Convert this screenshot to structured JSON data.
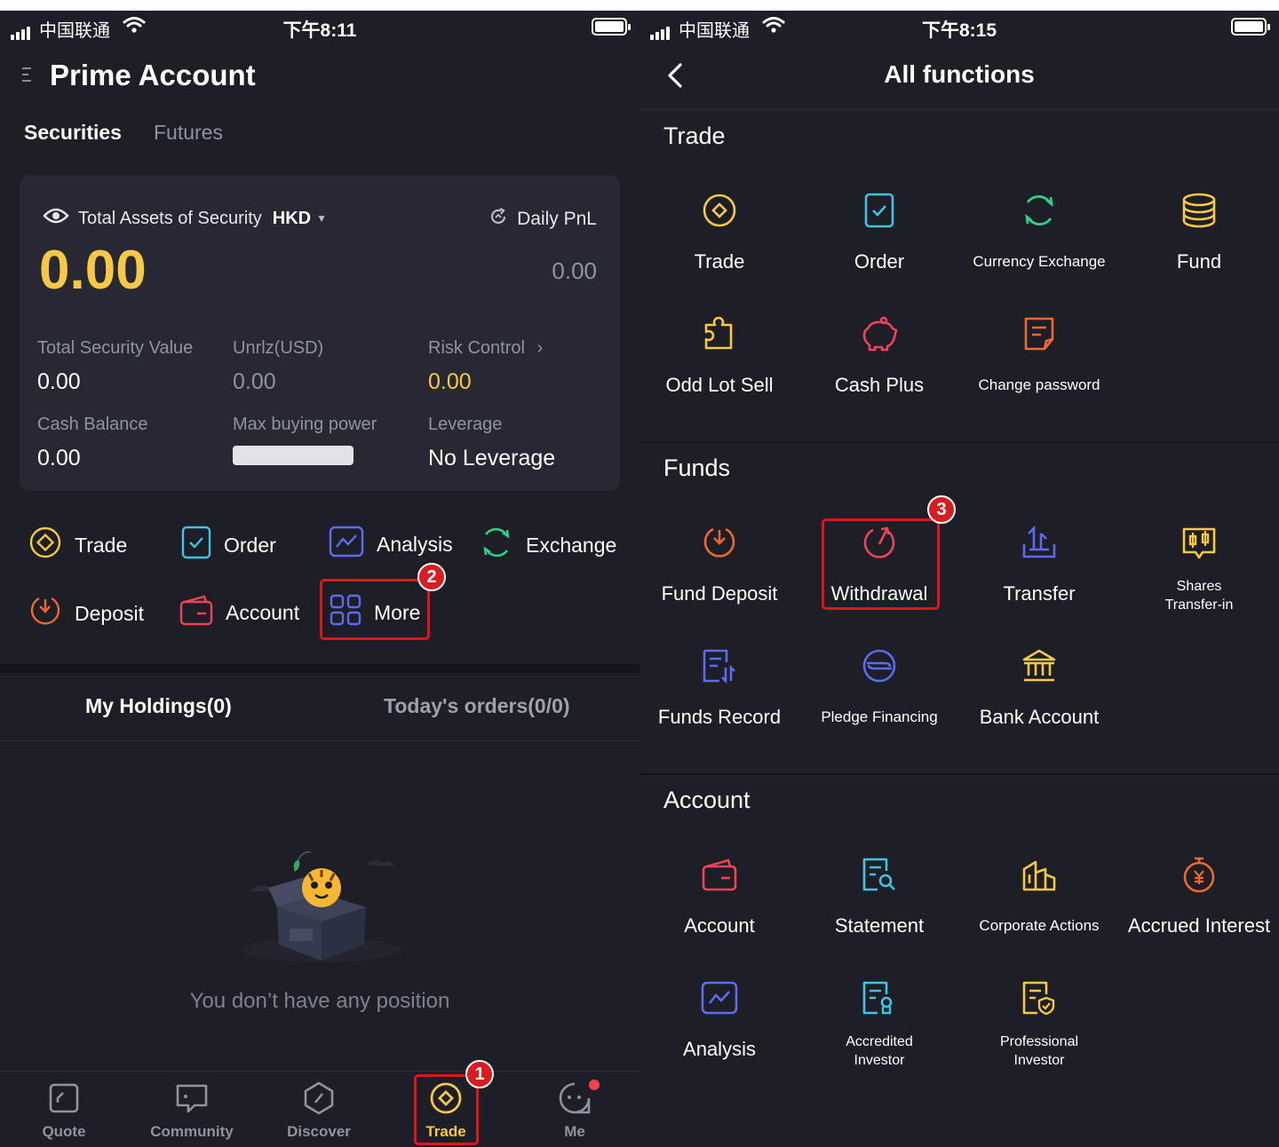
{
  "status_left": {
    "carrier": "中国联通",
    "time": "下午8:11"
  },
  "status_right": {
    "carrier": "中国联通",
    "time": "下午8:15"
  },
  "left": {
    "title": "Prime Account",
    "tabs": [
      "Securities",
      "Futures"
    ],
    "assets": {
      "label": "Total Assets of Security",
      "currency": "HKD",
      "daily_pnl_label": "Daily PnL",
      "total": "0.00",
      "daily_pnl_value": "0.00",
      "metrics": [
        {
          "label": "Total Security Value",
          "value": "0.00"
        },
        {
          "label": "Unrlz(USD)",
          "value": "0.00"
        },
        {
          "label": "Risk Control",
          "value": "0.00"
        },
        {
          "label": "Cash Balance",
          "value": "0.00"
        },
        {
          "label": "Max buying power",
          "value": ""
        },
        {
          "label": "Leverage",
          "value": "No Leverage"
        }
      ]
    },
    "quick_actions": [
      "Trade",
      "Order",
      "Analysis",
      "Exchange",
      "Deposit",
      "Account",
      "More"
    ],
    "holdings_tabs": [
      "My Holdings(0)",
      "Today's orders(0/0)"
    ],
    "empty_text": "You don’t have any position",
    "bottom_tabs": [
      "Quote",
      "Community",
      "Discover",
      "Trade",
      "Me"
    ]
  },
  "right": {
    "title": "All functions",
    "sections": [
      {
        "title": "Trade",
        "items": [
          "Trade",
          "Order",
          "Currency Exchange",
          "Fund",
          "Odd Lot Sell",
          "Cash Plus",
          "Change password"
        ]
      },
      {
        "title": "Funds",
        "items": [
          "Fund Deposit",
          "Withdrawal",
          "Transfer",
          "Shares Transfer-in",
          "Funds Record",
          "Pledge Financing",
          "Bank Account"
        ]
      },
      {
        "title": "Account",
        "items": [
          "Account",
          "Statement",
          "Corporate Actions",
          "Accrued Interest",
          "Analysis",
          "Accredited Investor",
          "Professional Investor"
        ]
      }
    ]
  },
  "annotations": [
    "1",
    "2",
    "3"
  ],
  "colors": {
    "background": "#1d1e26",
    "card": "#272833",
    "accent_gold": "#f7c844",
    "highlight_red": "#e0151c",
    "icon_orange": "#f0672f",
    "icon_blue": "#5b6cf0",
    "icon_cyan": "#3fc4e6",
    "icon_green": "#2fd18a"
  }
}
